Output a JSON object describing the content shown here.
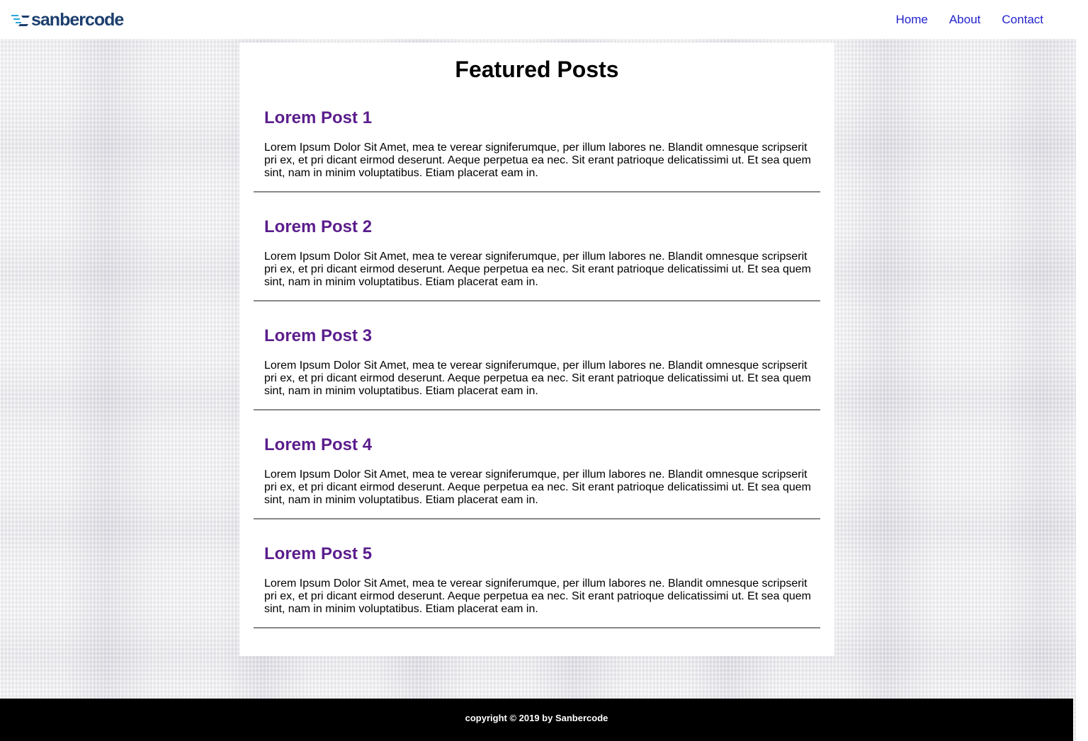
{
  "header": {
    "logo_text": "sanbercode",
    "nav": [
      {
        "label": "Home"
      },
      {
        "label": "About"
      },
      {
        "label": "Contact"
      }
    ]
  },
  "main": {
    "title": "Featured Posts",
    "posts": [
      {
        "title": "Lorem Post 1",
        "body": "Lorem Ipsum Dolor Sit Amet, mea te verear signiferumque, per illum labores ne. Blandit omnesque scripserit pri ex, et pri dicant eirmod deserunt. Aeque perpetua ea nec. Sit erant patrioque delicatissimi ut. Et sea quem sint, nam in minim voluptatibus. Etiam placerat eam in."
      },
      {
        "title": "Lorem Post 2",
        "body": "Lorem Ipsum Dolor Sit Amet, mea te verear signiferumque, per illum labores ne. Blandit omnesque scripserit pri ex, et pri dicant eirmod deserunt. Aeque perpetua ea nec. Sit erant patrioque delicatissimi ut. Et sea quem sint, nam in minim voluptatibus. Etiam placerat eam in."
      },
      {
        "title": "Lorem Post 3",
        "body": "Lorem Ipsum Dolor Sit Amet, mea te verear signiferumque, per illum labores ne. Blandit omnesque scripserit pri ex, et pri dicant eirmod deserunt. Aeque perpetua ea nec. Sit erant patrioque delicatissimi ut. Et sea quem sint, nam in minim voluptatibus. Etiam placerat eam in."
      },
      {
        "title": "Lorem Post 4",
        "body": "Lorem Ipsum Dolor Sit Amet, mea te verear signiferumque, per illum labores ne. Blandit omnesque scripserit pri ex, et pri dicant eirmod deserunt. Aeque perpetua ea nec. Sit erant patrioque delicatissimi ut. Et sea quem sint, nam in minim voluptatibus. Etiam placerat eam in."
      },
      {
        "title": "Lorem Post 5",
        "body": "Lorem Ipsum Dolor Sit Amet, mea te verear signiferumque, per illum labores ne. Blandit omnesque scripserit pri ex, et pri dicant eirmod deserunt. Aeque perpetua ea nec. Sit erant patrioque delicatissimi ut. Et sea quem sint, nam in minim voluptatibus. Etiam placerat eam in."
      }
    ]
  },
  "footer": {
    "text": "copyright © 2019 by Sanbercode"
  },
  "colors": {
    "post_title": "#5b1d8c",
    "nav_link": "#2222cc",
    "logo": "#1d3f6e",
    "footer_bg": "#000000"
  }
}
